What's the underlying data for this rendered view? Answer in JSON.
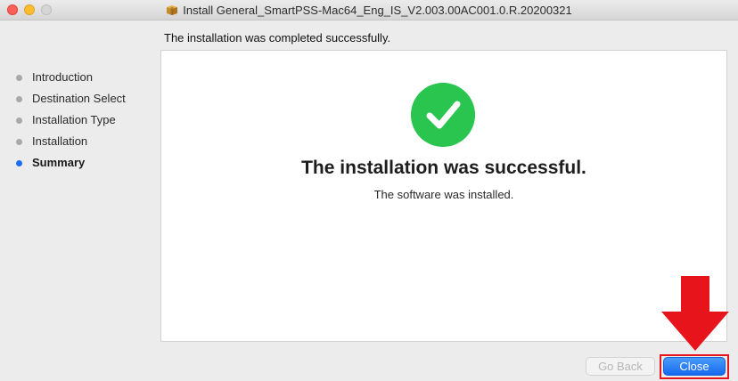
{
  "window": {
    "title": "Install General_SmartPSS-Mac64_Eng_IS_V2.003.00AC001.0.R.20200321",
    "title_icon": "package-icon"
  },
  "header": {
    "message": "The installation was completed successfully."
  },
  "sidebar": {
    "steps": [
      {
        "label": "Introduction",
        "active": false
      },
      {
        "label": "Destination Select",
        "active": false
      },
      {
        "label": "Installation Type",
        "active": false
      },
      {
        "label": "Installation",
        "active": false
      },
      {
        "label": "Summary",
        "active": true
      }
    ]
  },
  "main": {
    "icon": "checkmark-circle-icon",
    "title": "The installation was successful.",
    "subtitle": "The software was installed."
  },
  "buttons": {
    "go_back": "Go Back",
    "close": "Close"
  },
  "annotation": {
    "arrow_icon": "red-down-arrow-icon",
    "color": "#e8141c"
  },
  "colors": {
    "accent": "#1b6ef3",
    "success": "#2ac54f"
  }
}
